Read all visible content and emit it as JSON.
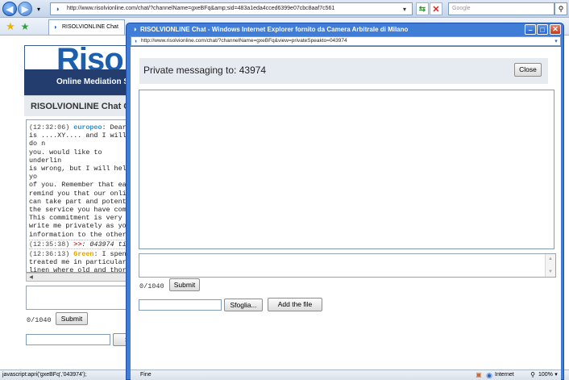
{
  "browser": {
    "address": "http://www.risolvionline.com/chat/?channelName=gxeBFq&amp;sid=483a1eda4cced6399e07cbc8aaf7c561",
    "search_placeholder": "Google",
    "tab_label": "RISOLVIONLINE Chat",
    "status_text": "javascript:apri('gxeBFq','043974');"
  },
  "background_page": {
    "logo": "Riso",
    "logo_sub": "Online Mediation S",
    "chat_title": "RISOLVIONLINE Chat C",
    "messages": [
      {
        "time": "(12:32:06)",
        "user": "europeo",
        "user_color": "#2a8fd0",
        "text": ": Dear\nis ....XY.... and I will do n\nyou. would like to underlin\nis wrong, but I will help yo\nof you. Remember that ea\nremind you that our online\ncan take part and potenti\nthe service you have com\nThis commitment is very i\nwrite me privately as you\ninformation to the other p"
      },
      {
        "time": "(12:35:38)",
        "user": ">>",
        "user_color": "#e02020",
        "text": ": 043974 ti i"
      },
      {
        "time": "(12:36:13)",
        "user": "Green",
        "user_color": "#e0a000",
        "text": ": I spent\ntreated me in particular a\nlinen where old and thorne\ncomplaining about the qu"
      }
    ],
    "counter": "0/1040",
    "submit_label": "Submit",
    "browse_label": "St"
  },
  "popup": {
    "title": "RISOLVIONLINE Chat - Windows Internet Explorer fornito da Camera Arbitrale di Milano",
    "address": "http://www.risolvionline.com/chat/?channelName=gxeBFq&view=privateSpeakto=043974",
    "heading": "Private messaging to: 43974",
    "close_label": "Close",
    "counter": "0/1040",
    "submit_label": "Submit",
    "browse_label": "Sfoglia...",
    "add_file_label": "Add the file",
    "status_left": "Fine",
    "status_zone": "Internet",
    "zoom": "100%"
  },
  "colors": {
    "popup_frame": "#3f7dd6",
    "header_bg": "#e6eaf1"
  }
}
